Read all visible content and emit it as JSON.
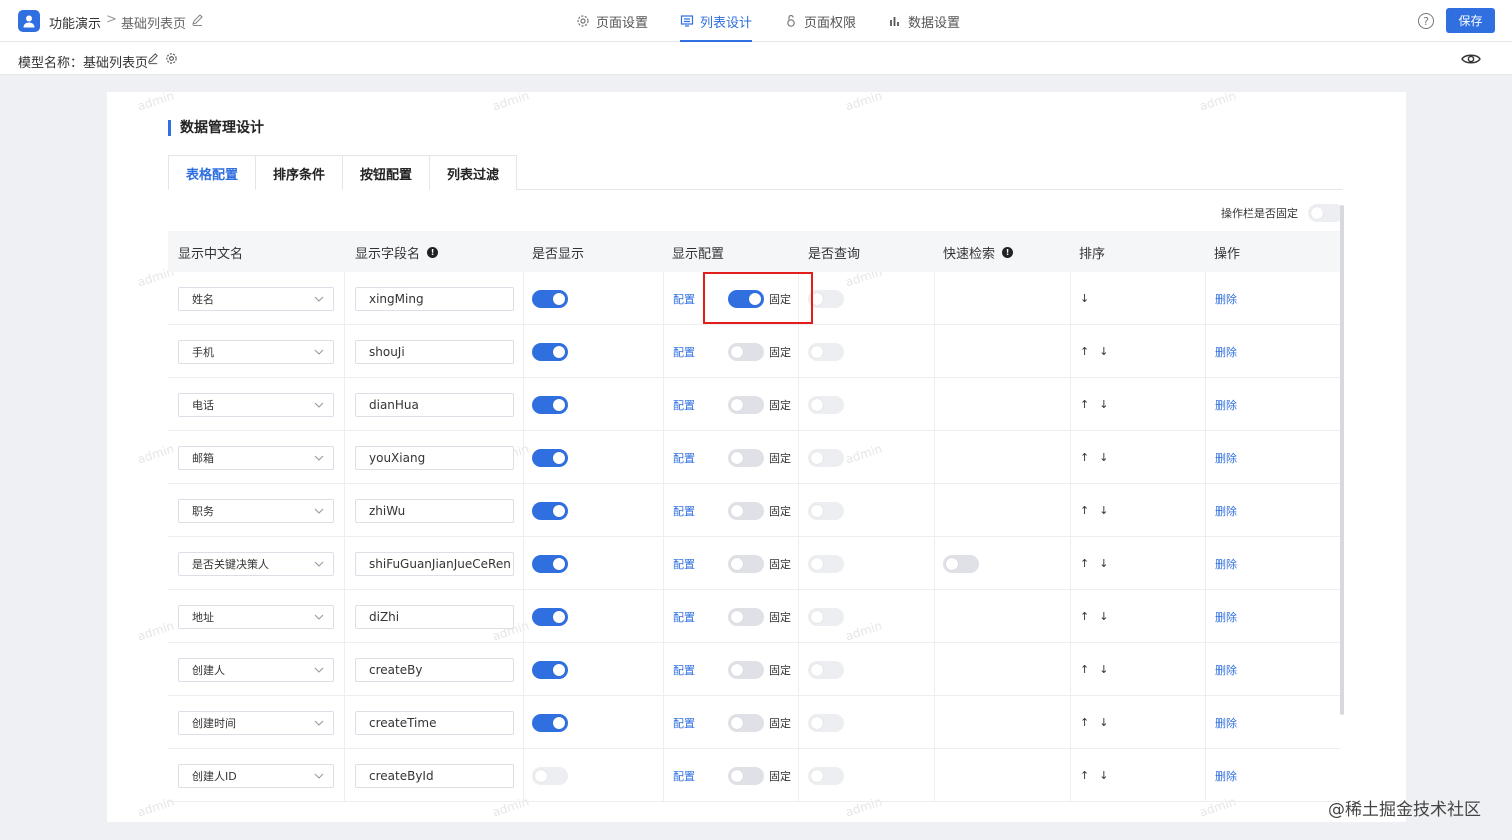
{
  "header": {
    "app_name": "功能演示",
    "crumb_sep": ">",
    "page_name": "基础列表页",
    "nav": [
      {
        "label": "页面设置",
        "icon": "gear-icon",
        "active": false
      },
      {
        "label": "列表设计",
        "icon": "list-icon",
        "active": true
      },
      {
        "label": "页面权限",
        "icon": "lock-icon",
        "active": false
      },
      {
        "label": "数据设置",
        "icon": "bar-chart-icon",
        "active": false
      }
    ],
    "help": "?",
    "save_label": "保存"
  },
  "model": {
    "label": "模型名称：基础列表页"
  },
  "section": {
    "title": "数据管理设计",
    "tabs": [
      "表格配置",
      "排序条件",
      "按钮配置",
      "列表过滤"
    ],
    "active_tab": 0,
    "pin_label": "操作栏是否固定"
  },
  "table": {
    "headers": [
      "显示中文名",
      "显示字段名",
      "是否显示",
      "显示配置",
      "是否查询",
      "快速检索",
      "排序",
      "操作"
    ],
    "config_link": "配置",
    "fixed_label": "固定",
    "delete_link": "删除",
    "up": "↑",
    "down": "↓",
    "rows": [
      {
        "cn": "姓名",
        "field": "xingMing",
        "show": true,
        "fixed": true,
        "query": false,
        "quick": false,
        "up": false
      },
      {
        "cn": "手机",
        "field": "shouJi",
        "show": true,
        "fixed": false,
        "query": false,
        "quick": false,
        "up": true
      },
      {
        "cn": "电话",
        "field": "dianHua",
        "show": true,
        "fixed": false,
        "query": false,
        "quick": false,
        "up": true
      },
      {
        "cn": "邮箱",
        "field": "youXiang",
        "show": true,
        "fixed": false,
        "query": false,
        "quick": false,
        "up": true
      },
      {
        "cn": "职务",
        "field": "zhiWu",
        "show": true,
        "fixed": false,
        "query": false,
        "quick": false,
        "up": true
      },
      {
        "cn": "是否关键决策人",
        "field": "shiFuGuanJianJueCeRen",
        "show": true,
        "fixed": false,
        "query": false,
        "quick": true,
        "up": true
      },
      {
        "cn": "地址",
        "field": "diZhi",
        "show": true,
        "fixed": false,
        "query": false,
        "quick": false,
        "up": true
      },
      {
        "cn": "创建人",
        "field": "createBy",
        "show": true,
        "fixed": false,
        "query": false,
        "quick": false,
        "up": true
      },
      {
        "cn": "创建时间",
        "field": "createTime",
        "show": true,
        "fixed": false,
        "query": false,
        "quick": false,
        "up": true
      },
      {
        "cn": "创建人ID",
        "field": "createById",
        "show": false,
        "fixed": false,
        "query": false,
        "quick": false,
        "up": true
      }
    ]
  },
  "watermark": "admin",
  "site_mark": "@稀土掘金技术社区",
  "colors": {
    "accent": "#2f6fe0",
    "highlight_box": "#e31c1c"
  }
}
